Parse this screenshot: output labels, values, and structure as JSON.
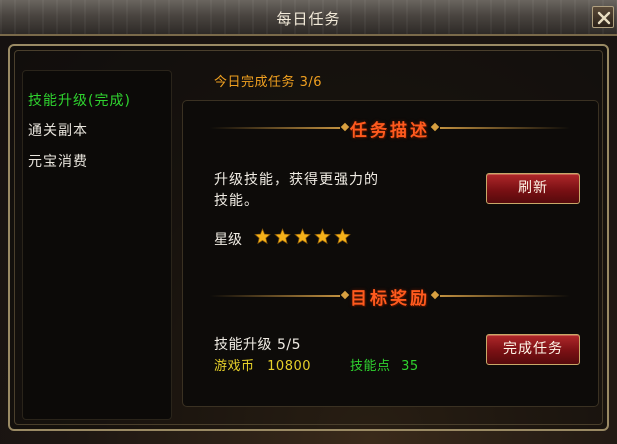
{
  "window": {
    "title": "每日任务"
  },
  "task_list": [
    {
      "label": "技能升级(完成)",
      "completed": true
    },
    {
      "label": "通关副本",
      "completed": false
    },
    {
      "label": "元宝消费",
      "completed": false
    }
  ],
  "progress": {
    "text": "今日完成任务 3/6"
  },
  "description_section": {
    "header": "任务描述",
    "text_line1": "升级技能，获得更强力的",
    "text_line2": "技能。",
    "star_label": "星级",
    "stars": 5,
    "refresh_button": "刷新"
  },
  "reward_section": {
    "header": "目标奖励",
    "goal": "技能升级 5/5",
    "coins_label": "游戏币",
    "coins_value": "10800",
    "skill_points_label": "技能点",
    "skill_points_value": "35",
    "complete_button": "完成任务"
  },
  "colors": {
    "completed_green": "#2fd32f",
    "progress_orange": "#f0a020",
    "header_red": "#ff5a1e",
    "coins_yellow": "#e6d02a",
    "skill_points_green": "#2fd32f",
    "star_gold": "#f5b21a",
    "button_red": "#8a181a"
  }
}
